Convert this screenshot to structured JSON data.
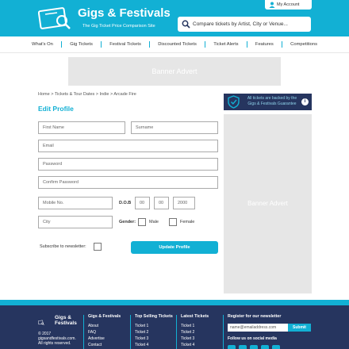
{
  "header": {
    "brand": "Gigs & Festivals",
    "tagline": "The Gig Ticket Price Comparison Site",
    "account_label": "My Account",
    "search_placeholder": "Compare tickets by Artist, City or Venue..."
  },
  "nav": {
    "items": [
      "What's On",
      "Gig Tickets",
      "Festival Tickets",
      "Discounted Tickets",
      "Ticket Alerts",
      "Features",
      "Competitions"
    ]
  },
  "banners": {
    "top": "Banner Advert",
    "side": "Banner Advert"
  },
  "breadcrumb": "Home > Tickets & Tour Dates > Indie > Arcade Fire",
  "form": {
    "title": "Edit Profile",
    "first_name": "First Name",
    "surname": "Surname",
    "email": "Email",
    "password": "Password",
    "confirm_password": "Confirm Password",
    "mobile": "Mobile No.",
    "dob_label": "D.O.B",
    "dob_day": "00",
    "dob_month": "00",
    "dob_year": "2000",
    "city": "City",
    "gender_label": "Gender:",
    "male_label": "Male",
    "female_label": "Female",
    "newsletter_label": "Subscribe to newsletter:",
    "update_button": "Update Profile"
  },
  "guarantee": {
    "text": "All tickets are backed by the Gigs & Festivals Guarantee",
    "info": "i"
  },
  "footer": {
    "logo_text_1": "Gigs &",
    "logo_text_2": "Festivals",
    "copyright_1": "© 2017",
    "copyright_2": "gigsandfestivals.com.",
    "copyright_3": "All rights reserved.",
    "col1": {
      "heading": "Gigs & Festivals",
      "items": [
        "About",
        "FAQ",
        "Advertise",
        "Contact"
      ]
    },
    "col2": {
      "heading": "Top Selling Tickets",
      "items": [
        "Ticket 1",
        "Ticket 2",
        "Ticket 3",
        "Ticket 4"
      ]
    },
    "col3": {
      "heading": "Latest Tickets",
      "items": [
        "Ticket 1",
        "Ticket 2",
        "Ticket 3",
        "Ticket 4"
      ]
    },
    "newsletter_heading": "Register for our newsletter",
    "newsletter_placeholder": "name@emailaddress.com",
    "newsletter_button": "Submit",
    "social_heading": "Follow us on social media"
  },
  "colors": {
    "accent": "#12b0d4",
    "navy": "#26355f",
    "advert": "#e6e6e6"
  }
}
